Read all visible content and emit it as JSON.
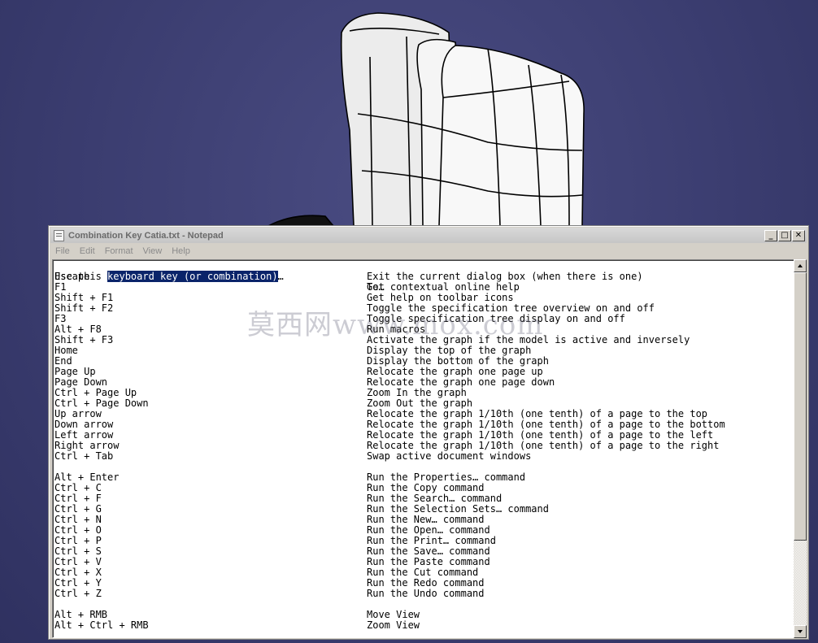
{
  "window": {
    "title": "Combination Key Catia.txt - Notepad",
    "buttons": {
      "minimize": "_",
      "maximize": "□",
      "close": "✕"
    }
  },
  "menu": [
    "File",
    "Edit",
    "Format",
    "View",
    "Help"
  ],
  "header": {
    "key_prefix": "Use this ",
    "key_selected": "keyboard key (or combination)",
    "key_suffix": "…",
    "description": "To…"
  },
  "rows": [
    {
      "key": "Escape",
      "desc": "Exit the current dialog box (when there is one)"
    },
    {
      "key": "F1",
      "desc": "Get contextual online help"
    },
    {
      "key": "Shift + F1",
      "desc": "Get help on toolbar icons"
    },
    {
      "key": "Shift + F2",
      "desc": "Toggle the specification tree overview on and off"
    },
    {
      "key": "F3",
      "desc": "Toggle specification tree display on and off"
    },
    {
      "key": "Alt + F8",
      "desc": "Run macros"
    },
    {
      "key": "Shift + F3",
      "desc": "Activate the graph if the model is active and inversely"
    },
    {
      "key": "Home",
      "desc": "Display the top of the graph"
    },
    {
      "key": "End",
      "desc": "Display the bottom of the graph"
    },
    {
      "key": "Page Up",
      "desc": "Relocate the graph one page up"
    },
    {
      "key": "Page Down",
      "desc": "Relocate the graph one page down"
    },
    {
      "key": "Ctrl + Page Up",
      "desc": "Zoom In the graph"
    },
    {
      "key": "Ctrl + Page Down",
      "desc": "Zoom Out the graph"
    },
    {
      "key": "Up arrow",
      "desc": "Relocate the graph 1/10th (one tenth) of a page to the top"
    },
    {
      "key": "Down arrow",
      "desc": "Relocate the graph 1/10th (one tenth) of a page to the bottom"
    },
    {
      "key": "Left arrow",
      "desc": "Relocate the graph 1/10th (one tenth) of a page to the left"
    },
    {
      "key": "Right arrow",
      "desc": "Relocate the graph 1/10th (one tenth) of a page to the right"
    },
    {
      "key": "Ctrl + Tab",
      "desc": "Swap active document windows"
    },
    {
      "key": "",
      "desc": ""
    },
    {
      "key": "Alt + Enter",
      "desc": "Run the Properties… command"
    },
    {
      "key": "Ctrl + C",
      "desc": "Run the Copy command"
    },
    {
      "key": "Ctrl + F",
      "desc": "Run the Search… command"
    },
    {
      "key": "Ctrl + G",
      "desc": "Run the Selection Sets… command"
    },
    {
      "key": "Ctrl + N",
      "desc": "Run the New… command"
    },
    {
      "key": "Ctrl + O",
      "desc": "Run the Open… command"
    },
    {
      "key": "Ctrl + P",
      "desc": "Run the Print… command"
    },
    {
      "key": "Ctrl + S",
      "desc": "Run the Save… command"
    },
    {
      "key": "Ctrl + V",
      "desc": "Run the Paste command"
    },
    {
      "key": "Ctrl + X",
      "desc": "Run the Cut command"
    },
    {
      "key": "Ctrl + Y",
      "desc": "Run the Redo command"
    },
    {
      "key": "Ctrl + Z",
      "desc": "Run the Undo command"
    },
    {
      "key": "",
      "desc": ""
    },
    {
      "key": "Alt + RMB",
      "desc": "Move View"
    },
    {
      "key": "Alt + Ctrl + RMB",
      "desc": "Zoom View"
    }
  ],
  "watermark": "莫西网www.mox.com",
  "colors": {
    "background": "#3b3d70",
    "selection": "#0a246a",
    "text": "#000000"
  }
}
